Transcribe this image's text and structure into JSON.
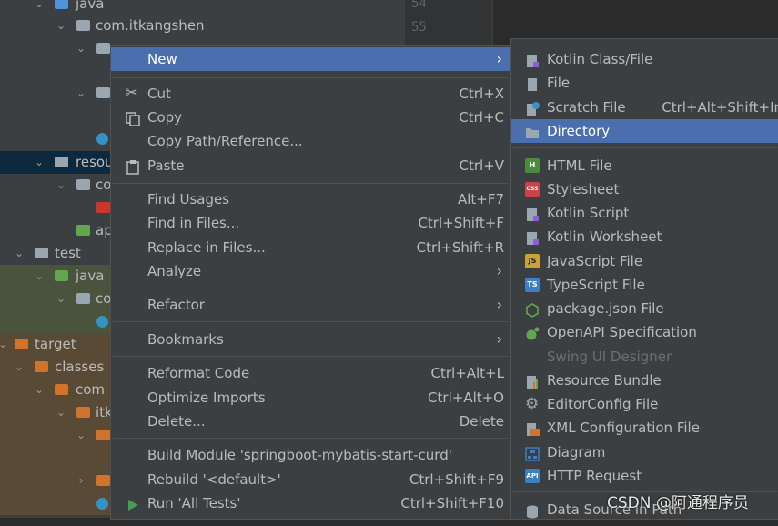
{
  "tree": {
    "rows": [
      {
        "label": "java"
      },
      {
        "label": "com.itkangshen"
      },
      {
        "label": ""
      },
      {
        "label": ""
      },
      {
        "label": ""
      },
      {
        "label": "resou"
      },
      {
        "label": "co"
      },
      {
        "label": ""
      },
      {
        "label": "ap"
      },
      {
        "label": "test"
      },
      {
        "label": "java"
      },
      {
        "label": "co"
      },
      {
        "label": ""
      },
      {
        "label": "target"
      },
      {
        "label": "classes"
      },
      {
        "label": "com"
      },
      {
        "label": "itk"
      },
      {
        "label": ""
      },
      {
        "label": ""
      },
      {
        "label": ""
      }
    ]
  },
  "gutter": {
    "lines": [
      "54",
      "55"
    ]
  },
  "context_menu": {
    "new": "New",
    "cut": "Cut",
    "cut_key": "Ctrl+X",
    "copy": "Copy",
    "copy_key": "Ctrl+C",
    "copy_path": "Copy Path/Reference...",
    "paste": "Paste",
    "paste_key": "Ctrl+V",
    "find_usages": "Find Usages",
    "find_usages_key": "Alt+F7",
    "find_in_files": "Find in Files...",
    "find_in_files_key": "Ctrl+Shift+F",
    "replace_in_files": "Replace in Files...",
    "replace_in_files_key": "Ctrl+Shift+R",
    "analyze": "Analyze",
    "refactor": "Refactor",
    "bookmarks": "Bookmarks",
    "reformat": "Reformat Code",
    "reformat_key": "Ctrl+Alt+L",
    "optimize": "Optimize Imports",
    "optimize_key": "Ctrl+Alt+O",
    "delete": "Delete...",
    "delete_key": "Delete",
    "build_module": "Build Module 'springboot-mybatis-start-curd'",
    "rebuild": "Rebuild '<default>'",
    "rebuild_key": "Ctrl+Shift+F9",
    "run_tests": "Run 'All Tests'",
    "run_tests_key": "Ctrl+Shift+F10"
  },
  "submenu": {
    "kotlin_class": "Kotlin Class/File",
    "file": "File",
    "scratch": "Scratch File",
    "scratch_key": "Ctrl+Alt+Shift+In",
    "directory": "Directory",
    "html": "HTML File",
    "stylesheet": "Stylesheet",
    "kotlin_script": "Kotlin Script",
    "kotlin_worksheet": "Kotlin Worksheet",
    "javascript": "JavaScript File",
    "typescript": "TypeScript File",
    "package_json": "package.json File",
    "openapi": "OpenAPI Specification",
    "swing": "Swing UI Designer",
    "resource_bundle": "Resource Bundle",
    "editorconfig": "EditorConfig File",
    "xml_config": "XML Configuration File",
    "diagram": "Diagram",
    "http_request": "HTTP Request",
    "data_source": "Data Source in Path",
    "badge_html": "H",
    "badge_css": "CSS",
    "badge_js": "JS",
    "badge_ts": "TS",
    "badge_api": "API"
  },
  "watermark": "CSDN @阿通程序员",
  "colors": {
    "selection": "#4b6eaf",
    "menu_bg": "#3c3f41",
    "tree_bg": "#3c3f41"
  }
}
